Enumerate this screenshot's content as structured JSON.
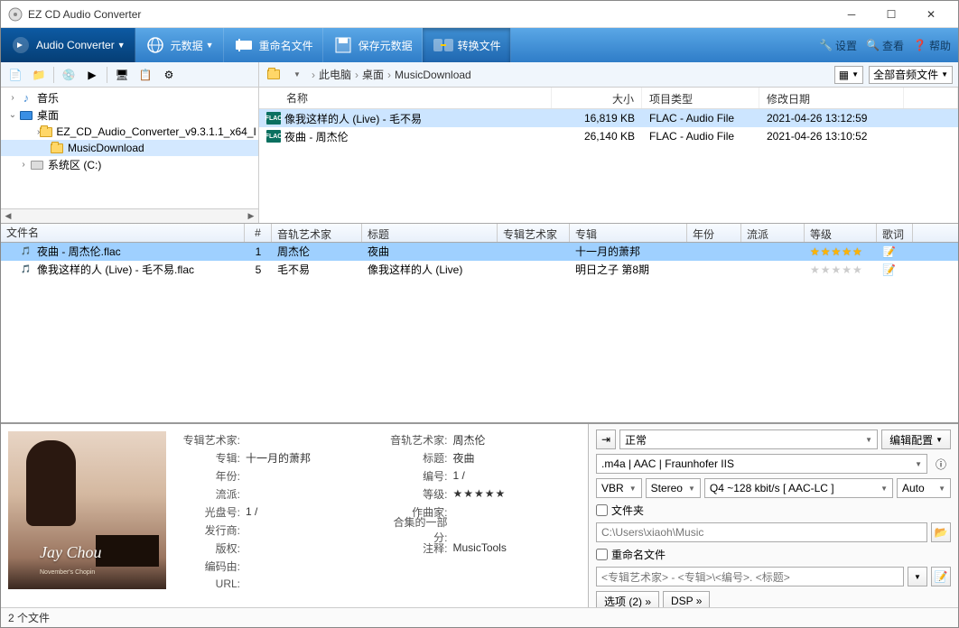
{
  "title": "EZ CD Audio Converter",
  "toolbar": {
    "audio_converter": "Audio Converter",
    "metadata": "元数据",
    "rename": "重命名文件",
    "save_meta": "保存元数据",
    "convert": "转换文件",
    "settings": "设置",
    "view": "查看",
    "help": "帮助"
  },
  "breadcrumb": {
    "b1": "此电脑",
    "b2": "桌面",
    "b3": "MusicDownload"
  },
  "filter": "全部音频文件",
  "tree": {
    "music": "音乐",
    "desktop": "桌面",
    "folder1": "EZ_CD_Audio_Converter_v9.3.1.1_x64_I",
    "folder2": "MusicDownload",
    "drive": "系统区 (C:)"
  },
  "filelist": {
    "h_name": "名称",
    "h_size": "大小",
    "h_type": "项目类型",
    "h_date": "修改日期",
    "rows": [
      {
        "name": "像我这样的人 (Live) - 毛不易",
        "size": "16,819 KB",
        "type": "FLAC - Audio File",
        "date": "2021-04-26 13:12:59"
      },
      {
        "name": "夜曲 - 周杰伦",
        "size": "26,140 KB",
        "type": "FLAC - Audio File",
        "date": "2021-04-26 13:10:52"
      }
    ]
  },
  "queue": {
    "h_file": "文件名",
    "h_num": "#",
    "h_artist": "音轨艺术家",
    "h_title": "标题",
    "h_aartist": "专辑艺术家",
    "h_album": "专辑",
    "h_year": "年份",
    "h_genre": "流派",
    "h_rating": "等级",
    "h_lyric": "歌词",
    "rows": [
      {
        "file": "夜曲 - 周杰伦.flac",
        "num": "1",
        "artist": "周杰伦",
        "title": "夜曲",
        "album": "十一月的萧邦"
      },
      {
        "file": "像我这样的人 (Live) - 毛不易.flac",
        "num": "5",
        "artist": "毛不易",
        "title": "像我这样的人 (Live)",
        "album": "明日之子 第8期"
      }
    ]
  },
  "cover_text": "Jay Chou",
  "cover_sub": "November's Chopin",
  "meta": {
    "l_aartist": "专辑艺术家:",
    "l_album": "专辑:",
    "l_year": "年份:",
    "l_genre": "流派:",
    "l_discid": "光盘号:",
    "l_publisher": "发行商:",
    "l_rights": "版权:",
    "l_encoder": "编码由:",
    "l_url": "URL:",
    "l_tartist": "音轨艺术家:",
    "l_title": "标题:",
    "l_tracknum": "编号:",
    "l_rating": "等级:",
    "l_composer": "作曲家:",
    "l_partof": "合集的一部分:",
    "l_comment": "注释:",
    "v_album": "十一月的萧邦",
    "v_discid": "1   /",
    "v_tartist": "周杰伦",
    "v_title": "夜曲",
    "v_tracknum": "1   /",
    "v_comment": "MusicTools"
  },
  "output": {
    "mode": "正常",
    "edit_config": "编辑配置",
    "format": ".m4a  |  AAC  |  Fraunhofer IIS",
    "vbr": "VBR",
    "stereo": "Stereo",
    "bitrate": "Q4 ~128 kbit/s [ AAC-LC ]",
    "auto": "Auto",
    "folder_chk": "文件夹",
    "folder_path": "C:\\Users\\xiaoh\\Music",
    "rename_chk": "重命名文件",
    "rename_pattern": "<专辑艺术家> - <专辑>\\<编号>. <标题>",
    "options": "选项 (2) »",
    "dsp": "DSP »"
  },
  "status": "2 个文件"
}
